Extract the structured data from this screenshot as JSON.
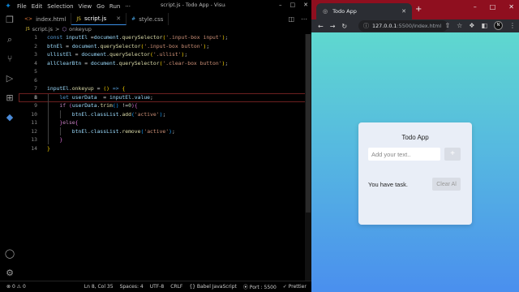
{
  "vscode": {
    "menu": [
      "File",
      "Edit",
      "Selection",
      "View",
      "Go",
      "Run",
      "···"
    ],
    "title": "script.js - Todo App - Visual Stu...",
    "tabs": [
      {
        "label": "index.html",
        "icon": "<>",
        "icon_color": "#e57a3c"
      },
      {
        "label": "script.js",
        "icon": "JS",
        "icon_color": "#e3c93a",
        "active": true
      },
      {
        "label": "style.css",
        "icon": "#",
        "icon_color": "#4aa8e8"
      }
    ],
    "breadcrumb": {
      "file": "script.js",
      "sep": ">",
      "symbol": "onkeyup"
    },
    "activity_icons": [
      "files-icon",
      "search-icon",
      "source-control-icon",
      "run-debug-icon",
      "extensions-icon",
      "python-icon"
    ],
    "status": {
      "errors": "0",
      "warnings": "0",
      "position": "Ln 8, Col 35",
      "spaces": "Spaces: 4",
      "encoding": "UTF-8",
      "eol": "CRLF",
      "language": "Babel JavaScript",
      "port": "Port : 5500",
      "prettier": "Prettier"
    }
  },
  "browser": {
    "tab_title": "Todo App",
    "url_host": "127.0.0.1",
    "url_path": ":5500/index.html",
    "avatar": "N"
  },
  "todo": {
    "title": "Todo App",
    "input_placeholder": "Add your text..",
    "add_label": "+",
    "count_text": "You have task.",
    "clear_label": "Clear Al"
  },
  "colors": {
    "gradient_top": "#5fd8cf",
    "gradient_bottom": "#4a8fee",
    "browser_frame": "#8f0f1f"
  }
}
